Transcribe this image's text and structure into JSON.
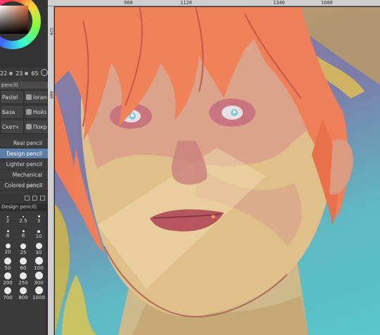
{
  "color_panel": {
    "hue_values": [
      "22",
      "23",
      "65"
    ]
  },
  "panel_tab": {
    "label": "pencil)"
  },
  "subtools": [
    {
      "label": "Pastel"
    },
    {
      "label": "lorandel"
    },
    {
      "label": "База"
    },
    {
      "label": "Нойз"
    },
    {
      "label": "Скетч"
    },
    {
      "label": "Покрас"
    }
  ],
  "brushes": [
    {
      "label": "Real pencil",
      "selected": false
    },
    {
      "label": "Design pencil",
      "selected": true
    },
    {
      "label": "Lighter pencil",
      "selected": false
    },
    {
      "label": "Mechanical pencil",
      "selected": false
    },
    {
      "label": "Colored pencil",
      "selected": false
    }
  ],
  "brush_size_panel": {
    "title": "Design pencil)",
    "sizes": [
      "2",
      "2.5",
      "3",
      "8",
      "8",
      "10",
      "20",
      "25",
      "30",
      "50",
      "60",
      "100",
      "200",
      "250",
      "300",
      "700",
      "800",
      "1000"
    ]
  },
  "ruler": {
    "top_ticks": [
      "960",
      "1120",
      "1340",
      "1600"
    ],
    "left_ticks": [
      "320",
      "480"
    ]
  },
  "canvas": {
    "subject": "illustration"
  }
}
